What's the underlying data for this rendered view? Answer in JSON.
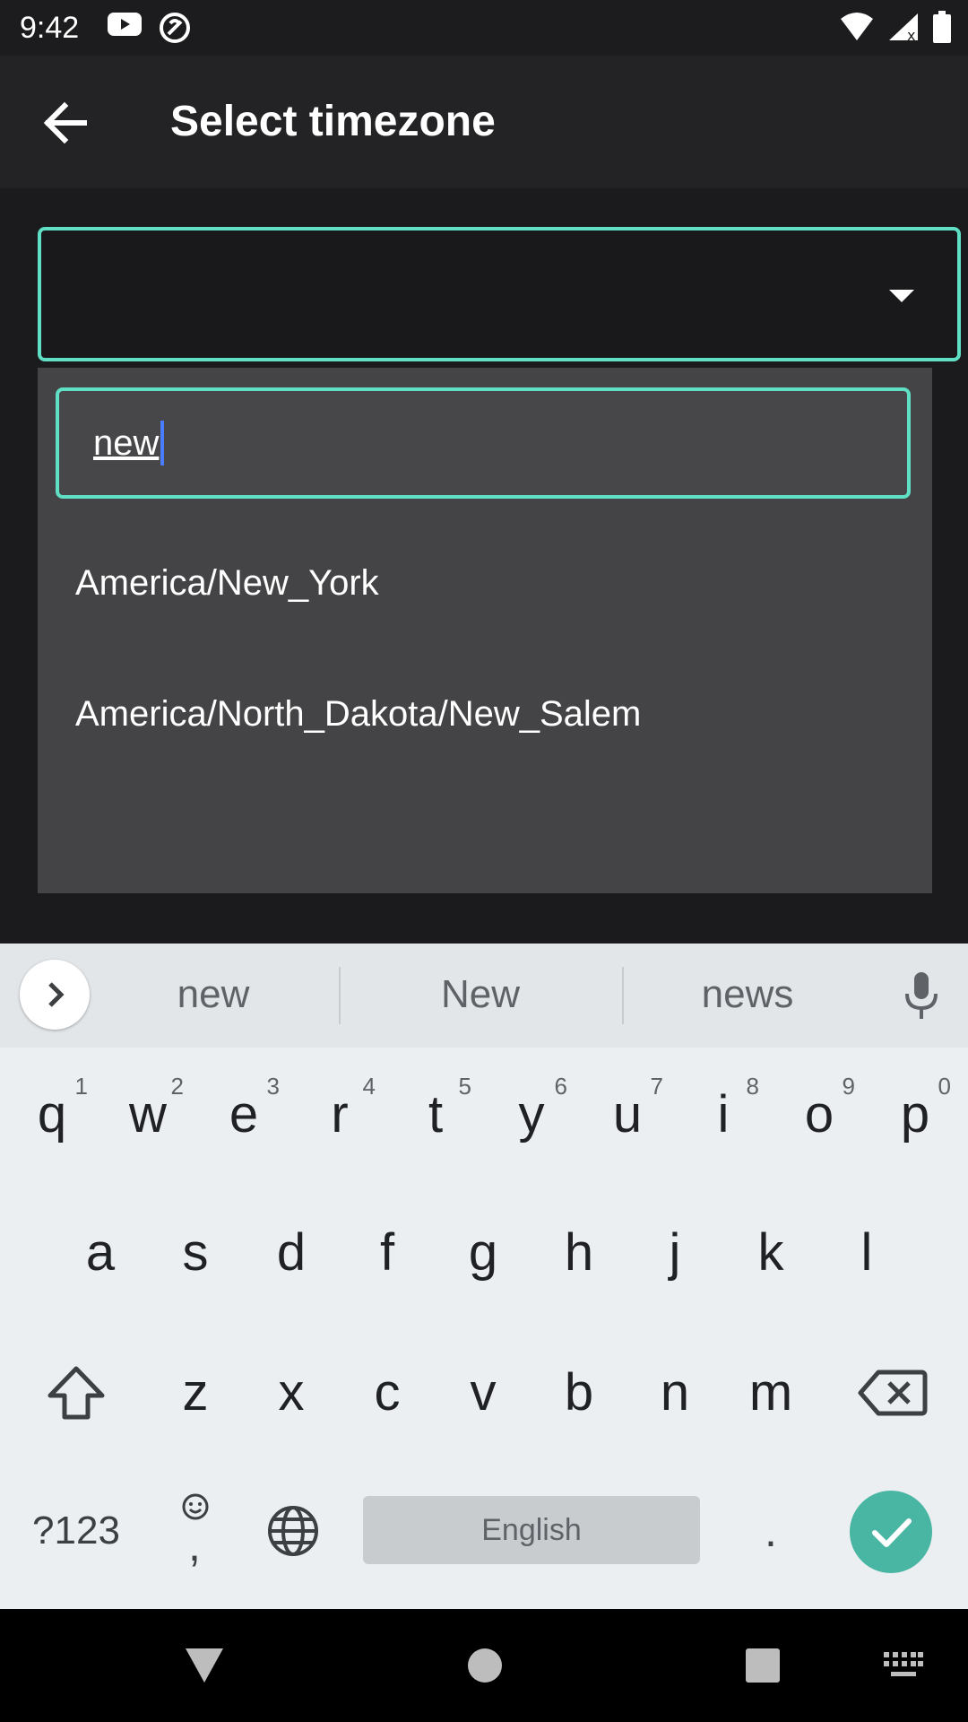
{
  "status_bar": {
    "time": "9:42",
    "left_icons": [
      "youtube-icon",
      "vpn-icon"
    ],
    "right_icons": [
      "wifi-icon",
      "cellular-icon",
      "battery-icon"
    ]
  },
  "app_bar": {
    "title": "Select timezone",
    "back_icon": "arrow-back-icon"
  },
  "select": {
    "value": "",
    "caret_icon": "chevron-down-icon"
  },
  "dropdown": {
    "search_value": "new",
    "options": [
      "America/New_York",
      "America/North_Dakota/New_Salem"
    ]
  },
  "keyboard": {
    "suggestions": [
      "new",
      "New",
      "news"
    ],
    "row1": [
      {
        "ch": "q",
        "num": "1"
      },
      {
        "ch": "w",
        "num": "2"
      },
      {
        "ch": "e",
        "num": "3"
      },
      {
        "ch": "r",
        "num": "4"
      },
      {
        "ch": "t",
        "num": "5"
      },
      {
        "ch": "y",
        "num": "6"
      },
      {
        "ch": "u",
        "num": "7"
      },
      {
        "ch": "i",
        "num": "8"
      },
      {
        "ch": "o",
        "num": "9"
      },
      {
        "ch": "p",
        "num": "0"
      }
    ],
    "row2": [
      "a",
      "s",
      "d",
      "f",
      "g",
      "h",
      "j",
      "k",
      "l"
    ],
    "row3": [
      "z",
      "x",
      "c",
      "v",
      "b",
      "n",
      "m"
    ],
    "symbols_label": "?123",
    "comma_label": ",",
    "space_label": "English",
    "period_label": ".",
    "accent_color": "#48b6a3"
  },
  "colors": {
    "focus_border": "#5fe0c4",
    "panel_bg": "#444446"
  }
}
